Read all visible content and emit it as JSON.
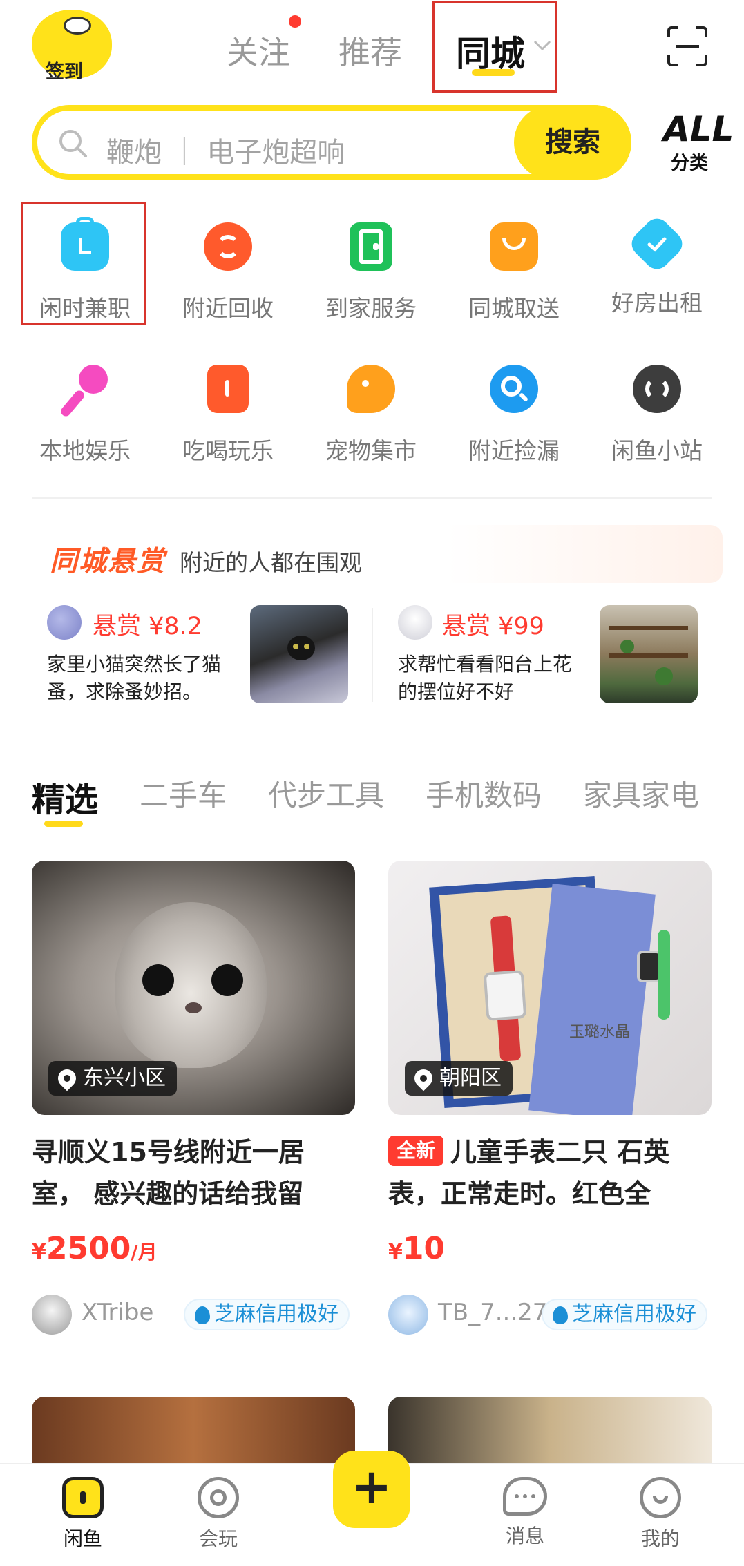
{
  "header": {
    "signin_label": "签到",
    "tabs": [
      "关注",
      "推荐",
      "同城"
    ],
    "active_tab": "同城"
  },
  "search": {
    "placeholder": "鞭炮 ｜ 电子炮超响",
    "button_label": "搜索",
    "all_big": "ALL",
    "all_small": "分类"
  },
  "grid": [
    {
      "label": "闲时兼职",
      "icon": "briefcase-icon",
      "color": "#2ec5f5"
    },
    {
      "label": "附近回收",
      "icon": "recycle-icon",
      "color": "#ff5a2c"
    },
    {
      "label": "到家服务",
      "icon": "door-icon",
      "color": "#1fc159"
    },
    {
      "label": "同城取送",
      "icon": "bag-icon",
      "color": "#ffa01c"
    },
    {
      "label": "好房出租",
      "icon": "house-check-icon",
      "color": "#2ec5f5"
    },
    {
      "label": "本地娱乐",
      "icon": "microphone-icon",
      "color": "#f54bc0"
    },
    {
      "label": "吃喝玩乐",
      "icon": "cup-icon",
      "color": "#ff5a2c"
    },
    {
      "label": "宠物集市",
      "icon": "dog-icon",
      "color": "#ffa01c"
    },
    {
      "label": "附近捡漏",
      "icon": "magnifier-icon",
      "color": "#1d9bf0"
    },
    {
      "label": "闲鱼小站",
      "icon": "station-icon",
      "color": "#3d3d3d"
    }
  ],
  "bounty": {
    "title": "同城悬赏",
    "subtitle": "附近的人都在围观",
    "items": [
      {
        "amount": "悬赏 ¥8.2",
        "desc_line1": "家里小猫突然长了猫",
        "desc_line2": "蚤，求除蚤妙招。"
      },
      {
        "amount": "悬赏 ¥99",
        "desc_line1": "求帮忙看看阳台上花",
        "desc_line2": "的摆位好不好"
      }
    ]
  },
  "categories": [
    "精选",
    "二手车",
    "代步工具",
    "手机数码",
    "家具家电"
  ],
  "cards": [
    {
      "location": "东兴小区",
      "title_line1": "寻顺义15号线附近一居",
      "title_line2": "室， 感兴趣的话给我留",
      "price_symbol": "¥",
      "price": "2500",
      "price_unit": "/月",
      "seller": "XTribe",
      "credit": "芝麻信用极好"
    },
    {
      "location": "朝阳区",
      "tag": "全新",
      "title_line1": "儿童手表二只 石英",
      "title_line2": "表，正常走时。红色全",
      "price_symbol": "¥",
      "price": "10",
      "seller": "TB_7...27",
      "credit": "芝麻信用极好"
    }
  ],
  "watch_box_text": "玉璐水晶",
  "nav": [
    {
      "label": "闲鱼",
      "icon": "home-fish-icon"
    },
    {
      "label": "会玩",
      "icon": "circle-icon"
    },
    {
      "label": "",
      "icon": "plus-icon"
    },
    {
      "label": "消息",
      "icon": "chat-icon"
    },
    {
      "label": "我的",
      "icon": "smile-icon"
    }
  ]
}
